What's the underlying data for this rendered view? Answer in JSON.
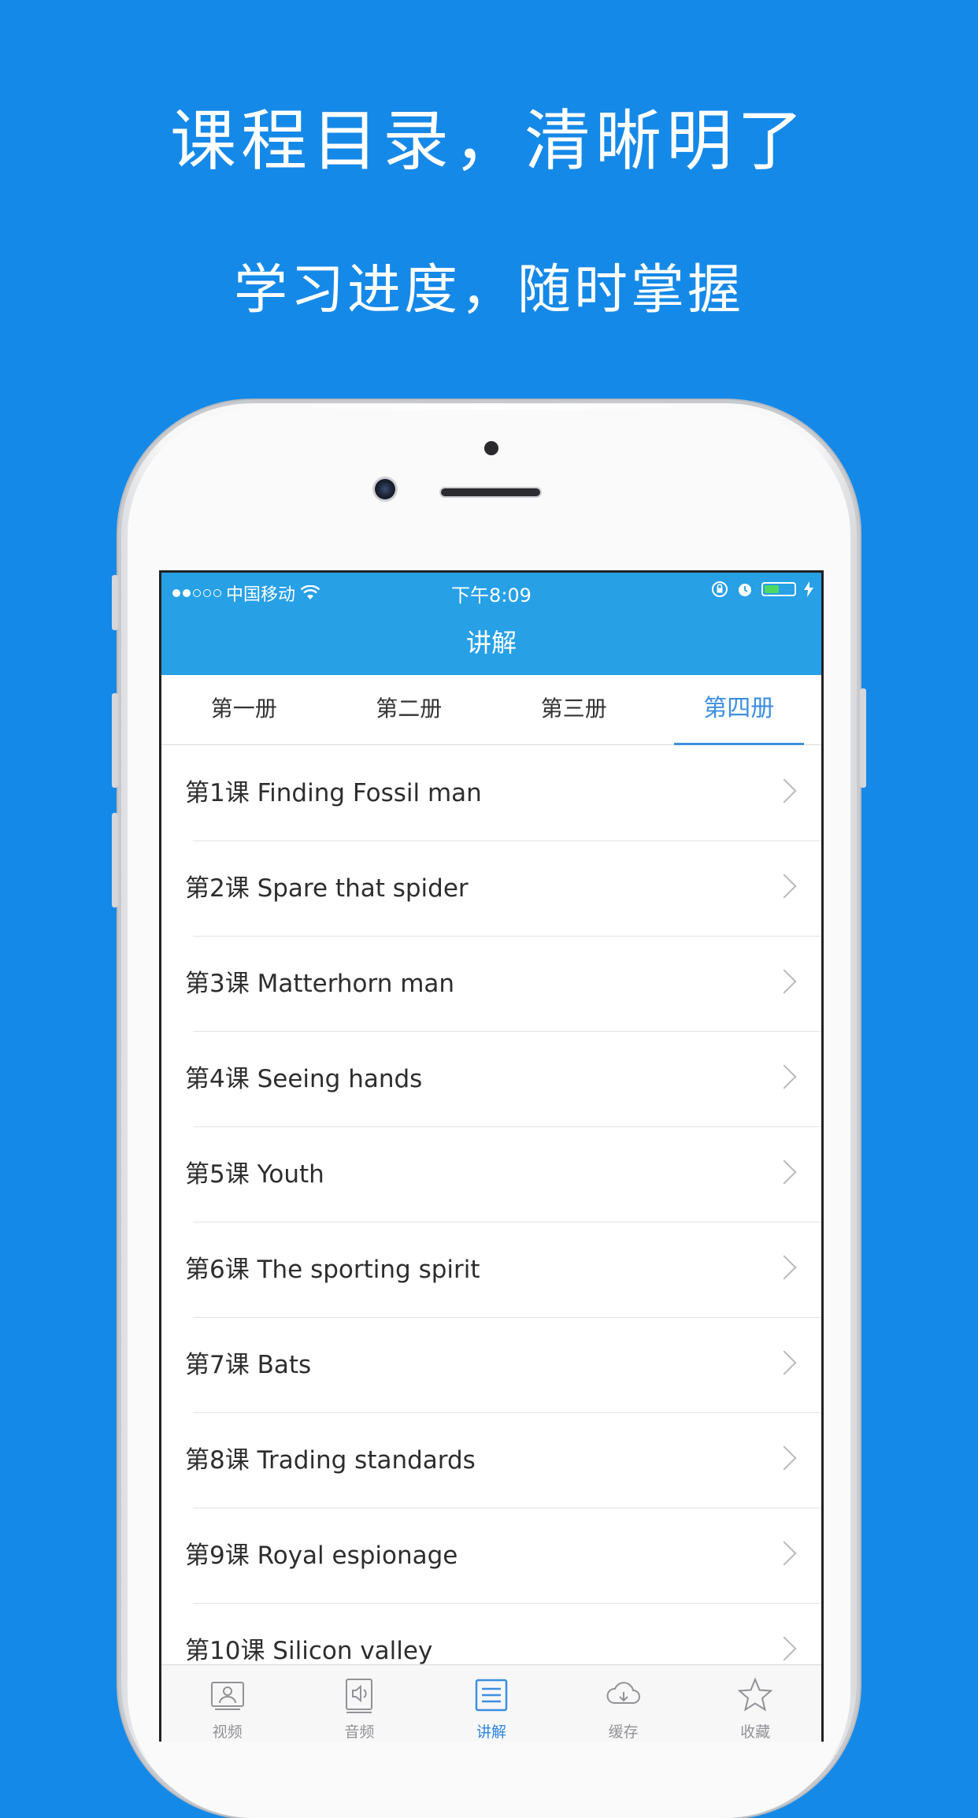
{
  "promo": {
    "headline": "课程目录，清晰明了",
    "subheadline": "学习进度，随时掌握"
  },
  "statusbar": {
    "carrier": "中国移动",
    "time": "下午8:09",
    "signal_dots_filled": 2,
    "signal_dots_total": 5,
    "battery_level": 0.5
  },
  "navbar": {
    "title": "讲解"
  },
  "tabs": [
    {
      "label": "第一册",
      "active": false
    },
    {
      "label": "第二册",
      "active": false
    },
    {
      "label": "第三册",
      "active": false
    },
    {
      "label": "第四册",
      "active": true
    }
  ],
  "lessons": [
    {
      "label": "第1课 Finding Fossil man"
    },
    {
      "label": "第2课 Spare that spider"
    },
    {
      "label": "第3课 Matterhorn man"
    },
    {
      "label": "第4课 Seeing hands"
    },
    {
      "label": "第5课 Youth"
    },
    {
      "label": "第6课 The sporting spirit"
    },
    {
      "label": "第7课 Bats"
    },
    {
      "label": "第8课 Trading standards"
    },
    {
      "label": "第9课 Royal espionage"
    },
    {
      "label": "第10课 Silicon valley"
    }
  ],
  "tabbar": [
    {
      "label": "视频",
      "icon": "video-icon",
      "active": false
    },
    {
      "label": "音频",
      "icon": "audio-icon",
      "active": false
    },
    {
      "label": "讲解",
      "icon": "list-icon",
      "active": true
    },
    {
      "label": "缓存",
      "icon": "cloud-download-icon",
      "active": false
    },
    {
      "label": "收藏",
      "icon": "star-icon",
      "active": false
    }
  ],
  "colors": {
    "background": "#1589e8",
    "navbar": "#27a0e6",
    "accent": "#3c8fe0",
    "battery": "#4cd964"
  }
}
